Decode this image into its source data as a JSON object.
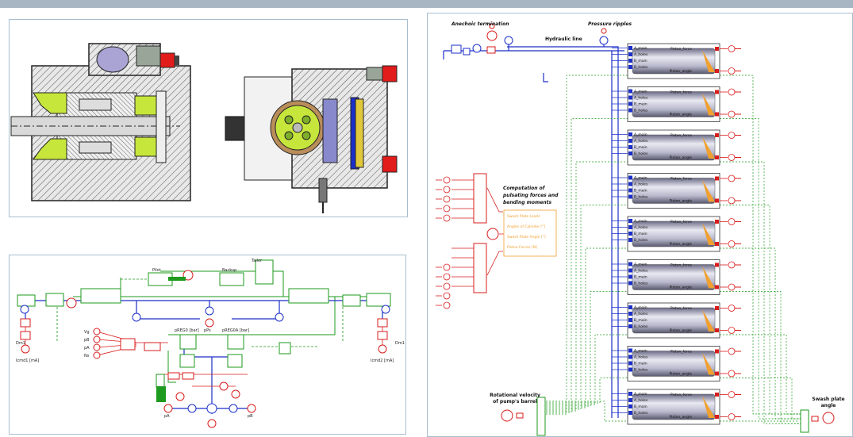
{
  "colors": {
    "hydraulic": "#1c2fc8",
    "signal_red": "#d91c1c",
    "mechanical_green": "#1e9a1e",
    "orange": "#f0a030",
    "yellow_green": "#c6e63c",
    "panel_border": "#a8bfd0",
    "topbar": "#a7b6c2"
  },
  "circuit": {
    "labels": {
      "pilot": "Pilot",
      "backup": "Backup",
      "tailer": "Tailer",
      "pr_left": "pREG0 [bar]",
      "pr_right": "pREG0A [bar]",
      "ps": "pPs",
      "vg": "Vg",
      "pb": "pB",
      "pa": "pA",
      "ns": "Ns",
      "dm_left": "Dm1",
      "dm_right": "Dm1",
      "current_left": "Icmd1 [mA]",
      "current_right": "Icmd2 [mA]",
      "port_a": "pA",
      "port_b": "pB"
    }
  },
  "model": {
    "labels": {
      "anechoic": "Anechoic termination",
      "pressure_ripples": "Pressure ripples",
      "hydraulic_line": "Hydraulic line",
      "computation": [
        "Computation of",
        "pulsating forces and",
        "bending moments"
      ],
      "rotational": [
        "Rotational velocity",
        "of pump's barrel"
      ],
      "swash": [
        "Swash plate",
        "angle"
      ]
    },
    "center_menu": [
      "Swash Plate Loads",
      "Angles of Cylinder [°]",
      "Swash Plate Angle [°]",
      "Piston Forces [N]"
    ],
    "piston_ports_left": [
      "A_main",
      "A_holes",
      "B_main",
      "B_holes"
    ],
    "piston_ports_right": [
      "Piston_force",
      "Piston_angle"
    ],
    "piston_count": 9
  }
}
